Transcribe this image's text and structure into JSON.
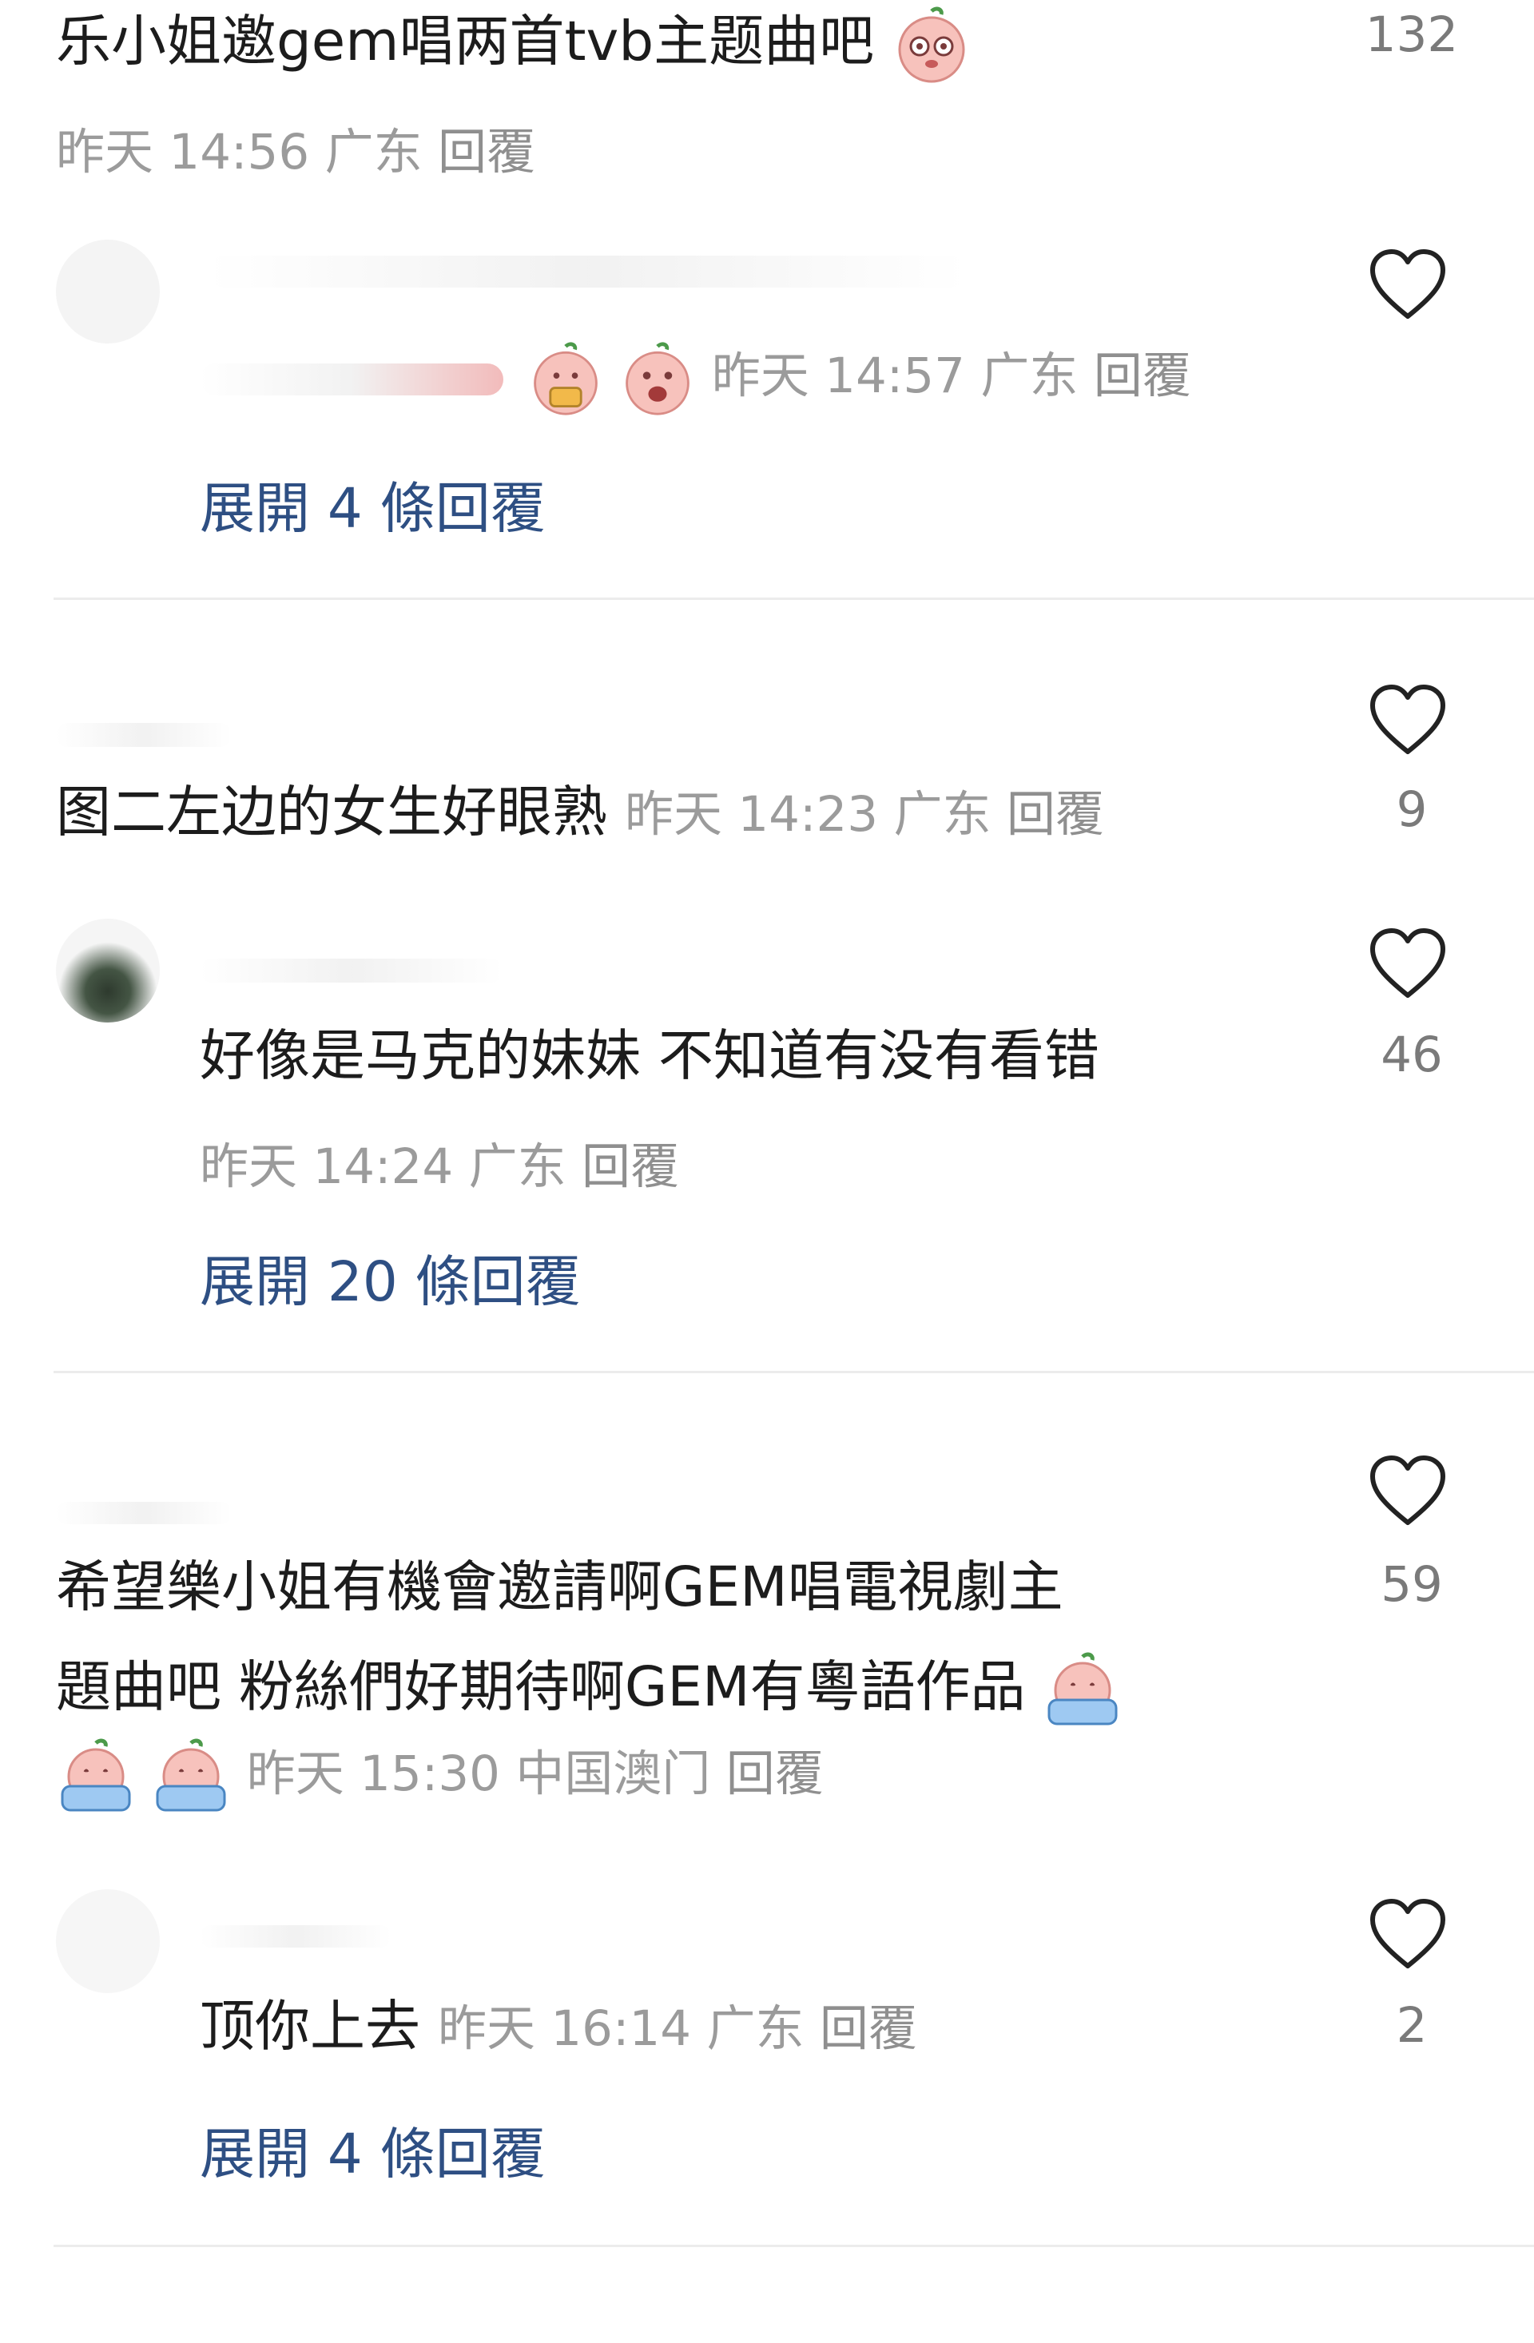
{
  "comments": [
    {
      "text": "乐小姐邀gem唱两首tvb主题曲吧",
      "time": "昨天 14:56",
      "location": "广东",
      "reply_label": "回覆",
      "likes": "132"
    },
    {
      "time": "昨天 14:57",
      "location": "广东",
      "reply_label": "回覆",
      "expand_label": "展開 4 條回覆"
    },
    {
      "text": "图二左边的女生好眼熟",
      "time": "昨天 14:23",
      "location": "广东",
      "reply_label": "回覆",
      "likes": "9"
    },
    {
      "text": "好像是马克的妹妹 不知道有没有看错",
      "time": "昨天 14:24",
      "location": "广东",
      "reply_label": "回覆",
      "likes": "46",
      "expand_label": "展開 20 條回覆"
    },
    {
      "text_line1": "希望樂小姐有機會邀請啊GEM唱電視劇主",
      "text_line2": "題曲吧 粉絲們好期待啊GEM有粵語作品",
      "time": "昨天 15:30",
      "location": "中国澳门",
      "reply_label": "回覆",
      "likes": "59"
    },
    {
      "text": "顶你上去",
      "time": "昨天 16:14",
      "location": "广东",
      "reply_label": "回覆",
      "likes": "2",
      "expand_label": "展開 4 條回覆"
    }
  ],
  "icons": {
    "heart": "heart-outline-icon",
    "emoji_peach": "peach-face-emoji",
    "emoji_cry": "crying-peach-emoji"
  },
  "colors": {
    "expand_link": "#2e4f83",
    "meta": "#9b9b9b",
    "text": "#1c1c1c"
  }
}
